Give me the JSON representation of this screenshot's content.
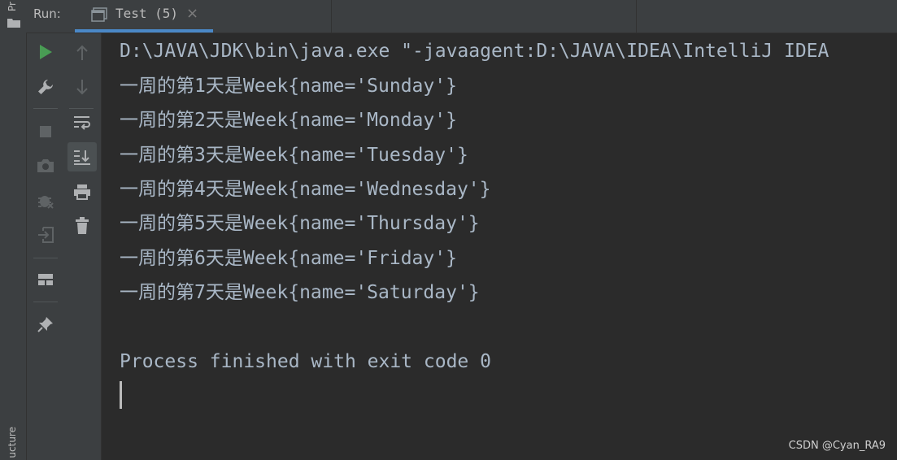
{
  "sidebar": {
    "top_label": "Pr",
    "bottom_label": "ucture"
  },
  "header": {
    "run_label": "Run:",
    "tab_title": "Test (5)",
    "tab_close": "×"
  },
  "console": {
    "lines": [
      "D:\\JAVA\\JDK\\bin\\java.exe \"-javaagent:D:\\JAVA\\IDEA\\IntelliJ IDEA",
      "一周的第1天是Week{name='Sunday'}",
      "一周的第2天是Week{name='Monday'}",
      "一周的第3天是Week{name='Tuesday'}",
      "一周的第4天是Week{name='Wednesday'}",
      "一周的第5天是Week{name='Thursday'}",
      "一周的第6天是Week{name='Friday'}",
      "一周的第7天是Week{name='Saturday'}",
      "",
      "Process finished with exit code 0"
    ]
  },
  "watermark": "CSDN @Cyan_RA9",
  "colors": {
    "run_green": "#499c54",
    "accent_blue": "#4a88c7",
    "icon_grey": "#afb1b3",
    "icon_disabled": "#5f6365",
    "text": "#a9b7c6"
  }
}
